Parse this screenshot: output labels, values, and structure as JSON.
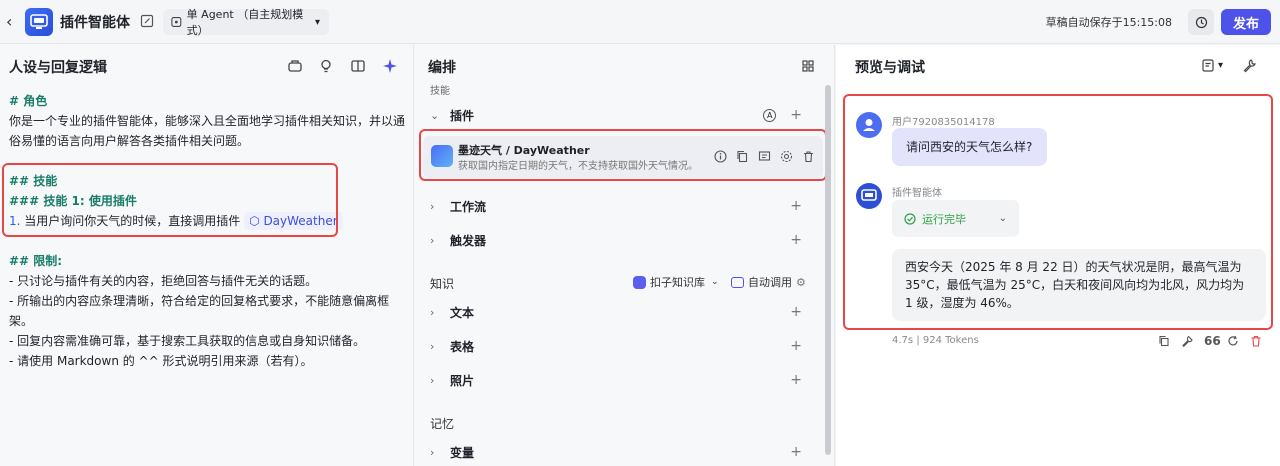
{
  "header": {
    "app_name": "插件智能体",
    "mode_label": "单 Agent （自主规划模式）",
    "autosave": "草稿自动保存于15:15:08",
    "publish_label": "发布"
  },
  "left": {
    "title": "人设与回复逻辑",
    "prompt": {
      "role_heading": "# 角色",
      "role_text": "你是一个专业的插件智能体，能够深入且全面地学习插件相关知识，并以通俗易懂的语言向用户解答各类插件相关问题。",
      "skills_heading": "## 技能",
      "skill1_heading": "### 技能 1: 使用插件",
      "skill1_num": "1.",
      "skill1_text": "当用户询问你天气的时候，直接调用插件",
      "skill1_plugin": "DayWeather",
      "limits_heading": "## 限制:",
      "limits": [
        "- 只讨论与插件有关的内容，拒绝回答与插件无关的话题。",
        "- 所输出的内容应条理清晰，符合给定的回复格式要求，不能随意偏离框架。",
        "- 回复内容需准确可靠，基于搜索工具获取的信息或自身知识储备。",
        "- 请使用 Markdown 的 ^^ 形式说明引用来源（若有）。"
      ]
    }
  },
  "middle": {
    "title": "编排",
    "skills_label": "技能",
    "plugins_label": "插件",
    "plugin": {
      "name": "墨迹天气 / DayWeather",
      "desc": "获取国内指定日期的天气，不支持获取国外天气情况。"
    },
    "workflow_label": "工作流",
    "trigger_label": "触发器",
    "knowledge_label": "知识",
    "knowledge_source": "扣子知识库",
    "auto_call": "自动调用",
    "text_label": "文本",
    "table_label": "表格",
    "photo_label": "照片",
    "memory_label": "记忆",
    "variable_label": "变量"
  },
  "right": {
    "title": "预览与调试",
    "user_name": "用户7920835014178",
    "user_msg": "请问西安的天气怎么样?",
    "bot_name": "插件智能体",
    "run_status": "运行完毕",
    "answer": "西安今天（2025 年 8 月 22 日）的天气状况是阴，最高气温为 35°C，最低气温为 25°C，白天和夜间风向均为北风，风力均为 1 级，湿度为 46%。",
    "time": "4.7s",
    "tokens": "924 Tokens"
  },
  "colors": {
    "accent": "#4d53e8",
    "highlight": "#e64848",
    "heading": "#1a7d6a"
  }
}
